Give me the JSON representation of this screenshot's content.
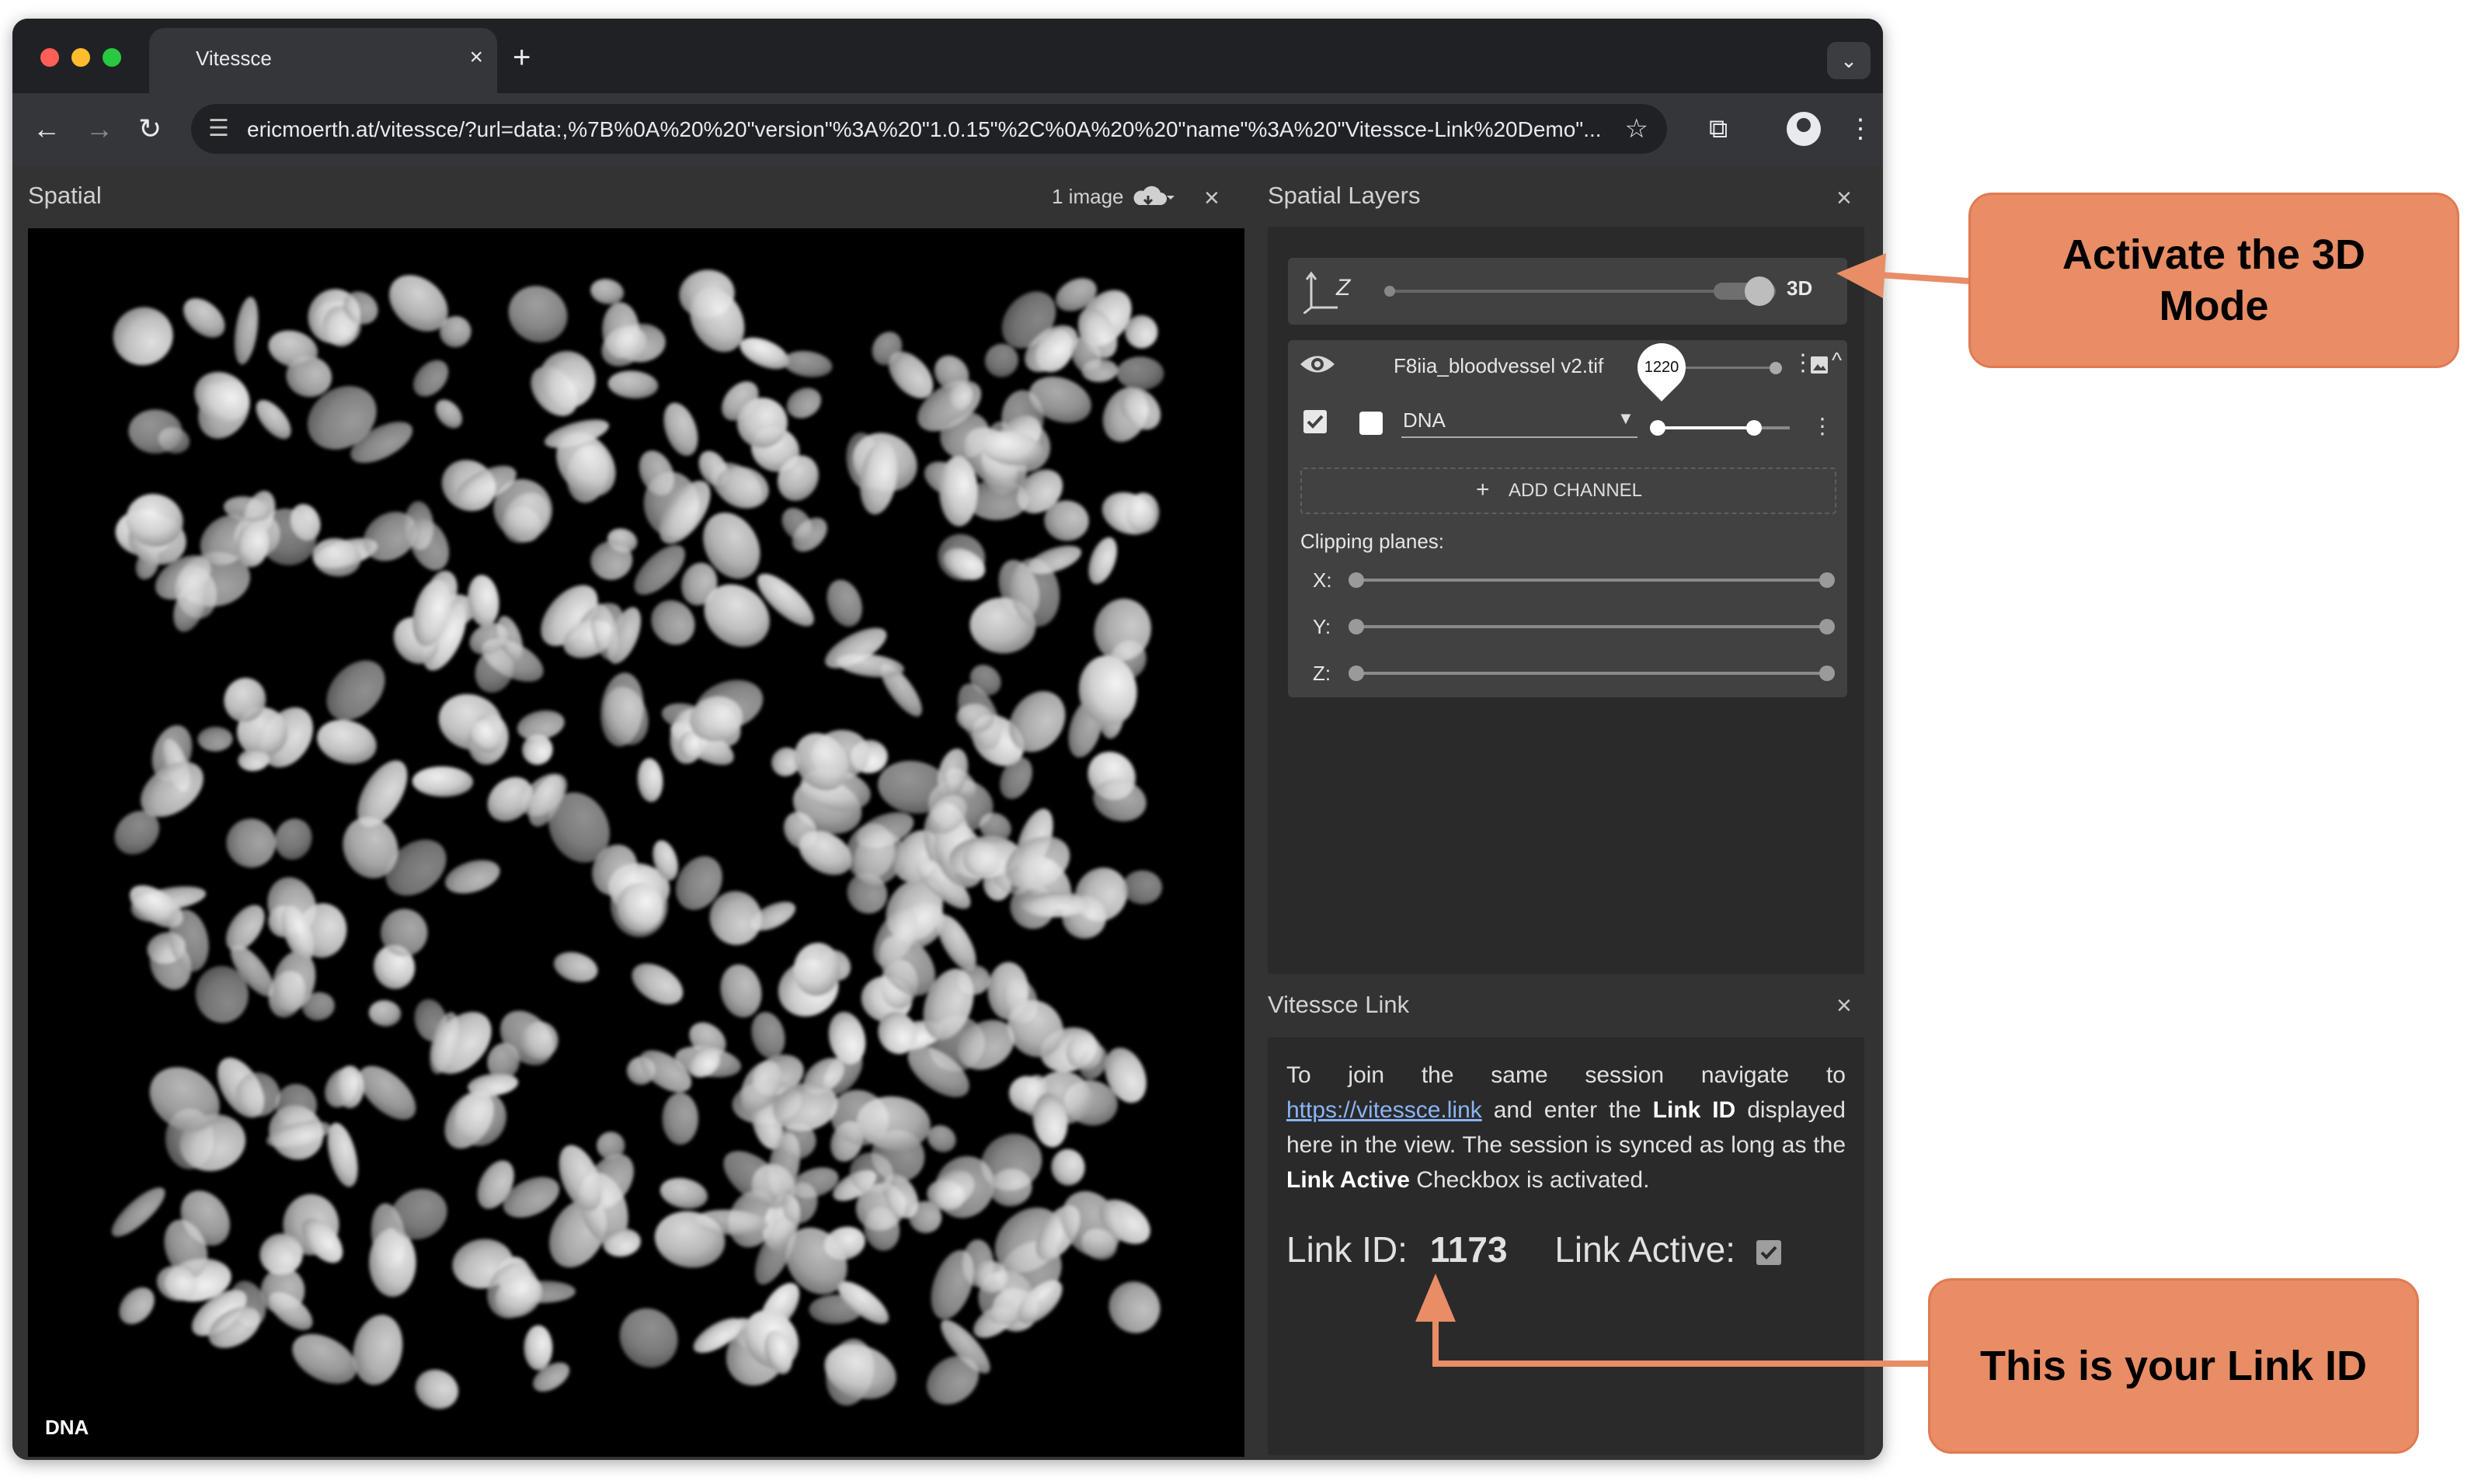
{
  "browser": {
    "tab_title": "Vitessce",
    "url": "ericmoerth.at/vitessce/?url=data:,%7B%0A%20%20\"version\"%3A%20\"1.0.15\"%2C%0A%20%20\"name\"%3A%20\"Vitessce-Link%20Demo\"..."
  },
  "spatial": {
    "title": "Spatial",
    "image_count": "1 image",
    "channel_label": "DNA"
  },
  "layers": {
    "title": "Spatial Layers",
    "mode_label": "3D",
    "axis_z_label": "Z",
    "image_name": "F8iia_bloodvessel v2.tif",
    "slider_value": "1220",
    "channel_name": "DNA",
    "add_channel_label": "ADD CHANNEL",
    "clipping_label": "Clipping planes:",
    "clip_x": "X:",
    "clip_y": "Y:",
    "clip_z": "Z:"
  },
  "link": {
    "title": "Vitessce Link",
    "text_1": "To join the same session navigate to",
    "url": "https://vitessce.link",
    "text_2": " and enter the ",
    "bold_1": "Link ID",
    "text_3": " displayed here in the view. The session is synced as long as the ",
    "bold_2": "Link Active",
    "text_4": " Checkbox is activated.",
    "id_label": "Link ID:",
    "id_value": "1173",
    "active_label": "Link Active:"
  },
  "callouts": {
    "top": "Activate the 3D Mode",
    "bottom": "This is your Link ID"
  },
  "colors": {
    "callout_fill": "#e88d66",
    "link_blue": "#8ab4f8"
  },
  "icons": [
    "eye-icon",
    "image-icon",
    "cloud-download-icon",
    "close-icon",
    "axis-icon",
    "chevron-up-icon",
    "more-vert-icon",
    "checkbox-icon"
  ]
}
